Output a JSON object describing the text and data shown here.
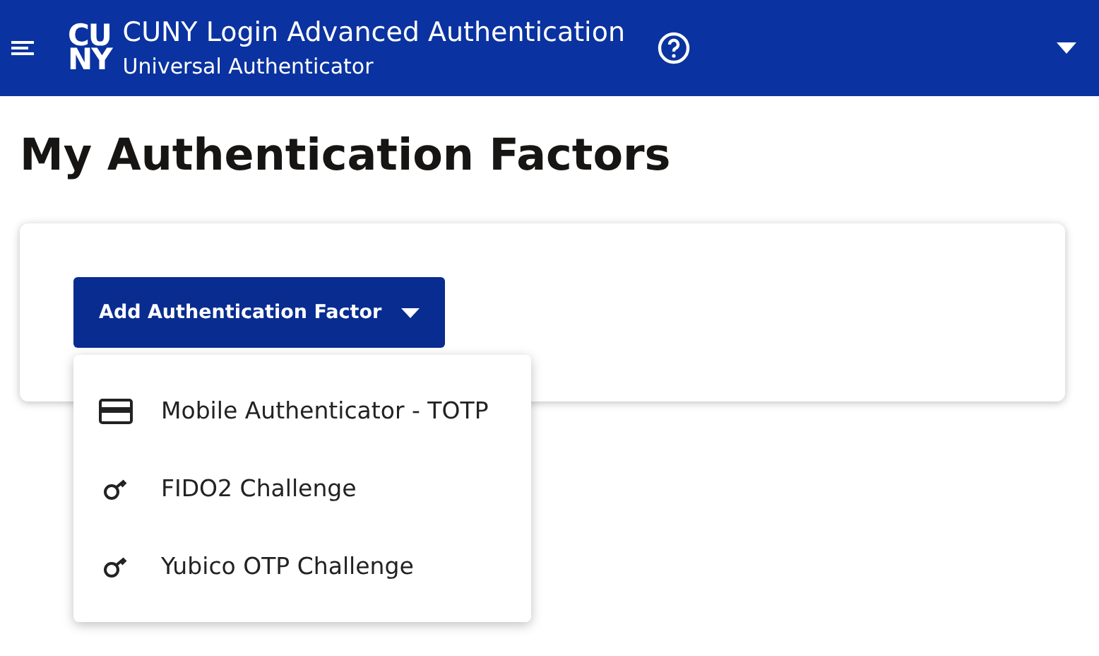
{
  "header": {
    "logo": [
      "CU",
      "NY"
    ],
    "title": "CUNY Login Advanced Authentication",
    "subtitle": "Universal Authenticator"
  },
  "page_title": "My Authentication Factors",
  "add_button": {
    "label": "Add Authentication Factor",
    "expanded": true
  },
  "menu": [
    {
      "label": "Mobile Authenticator - TOTP",
      "kind": "card"
    },
    {
      "label": "FIDO2 Challenge",
      "kind": "key"
    },
    {
      "label": "Yubico OTP Challenge",
      "kind": "key"
    }
  ]
}
